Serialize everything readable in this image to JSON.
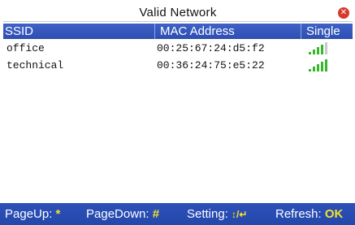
{
  "window": {
    "title": "Valid Network",
    "close_icon": "close-icon"
  },
  "table": {
    "headers": [
      "SSID",
      "MAC Address",
      "Single"
    ],
    "rows": [
      {
        "ssid": "office",
        "mac": "00:25:67:24:d5:f2",
        "signal_level": 4,
        "signal_max": 5
      },
      {
        "ssid": "technical",
        "mac": "00:36:24:75:e5:22",
        "signal_level": 5,
        "signal_max": 5
      }
    ]
  },
  "footer": {
    "pageup_label": "PageUp:",
    "pageup_key": "*",
    "pagedown_label": "PageDown:",
    "pagedown_key": "#",
    "setting_label": "Setting:",
    "setting_key": "↕/↵",
    "refresh_label": "Refresh:",
    "refresh_key": "OK"
  },
  "colors": {
    "header_bg": "#3f62c8",
    "footer_bg": "#2c51b9",
    "signal_on": "#37b82b",
    "signal_off": "#c9c9c9",
    "key_highlight": "#f4e12a",
    "close_icon": "#d63a2e"
  }
}
